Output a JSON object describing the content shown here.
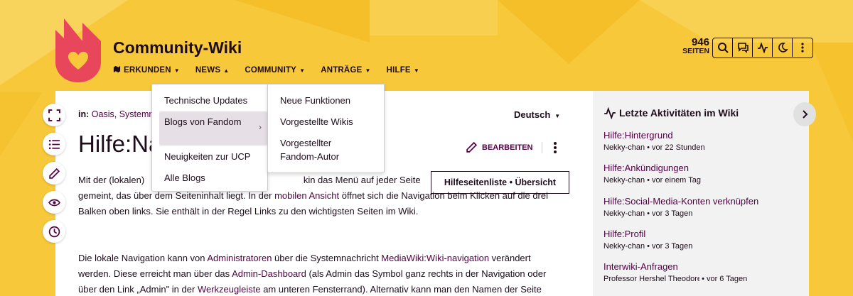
{
  "header": {
    "wiki_title": "Community-Wiki",
    "pages_count": "946",
    "pages_label": "SEITEN"
  },
  "nav": {
    "items": [
      {
        "label": "ERKUNDEN"
      },
      {
        "label": "NEWS"
      },
      {
        "label": "COMMUNITY"
      },
      {
        "label": "ANTRÄGE"
      },
      {
        "label": "HILFE"
      }
    ]
  },
  "dropdown": {
    "items": [
      {
        "label": "Technische Updates"
      },
      {
        "label": "Blogs von Fandom"
      },
      {
        "label": "Neuigkeiten zur UCP"
      },
      {
        "label": "Alle Blogs"
      }
    ],
    "submenu": [
      {
        "label": "Neue Funktionen"
      },
      {
        "label": "Vorgestellte Wikis"
      },
      {
        "label": "Vorgestellter Fandom-Autor"
      }
    ]
  },
  "page": {
    "breadcrumb_prefix": "in:",
    "breadcrumb_link_1": "Oasis",
    "breadcrumb_sep": ",",
    "breadcrumb_link_2": "Systemn",
    "language": "Deutsch",
    "title": "Hilfe:Navigation",
    "edit_label": "BEARBEITEN",
    "help_box": "Hilfeseitenliste • Übersicht",
    "p1a_1": "Mit der (lokalen) ",
    "p1a_2": "kin das Menü auf jeder Seite",
    "p1b_1": "gemeint, das über dem Seiteninhalt liegt. In der ",
    "p1b_link": "mobilen Ansicht",
    "p1b_2": " öffnet sich die Navigation beim Klicken auf die drei Balken oben links. Sie enthält in der Regel Links zu den wichtigsten Seiten im Wiki.",
    "p2_1": "Die lokale Navigation kann von ",
    "p2_link1": "Administratoren",
    "p2_2": " über die Systemnachricht ",
    "p2_link2": "MediaWiki:Wiki-navigation",
    "p2_3": " verändert werden. Diese erreicht man über das ",
    "p2_link3": "Admin-Dashboard",
    "p2_4": " (als Admin das Symbol ganz rechts in der Navigation oder über den Link „Admin\" in der ",
    "p2_link4": "Werkzeugleiste",
    "p2_5": " am unteren Fensterrand). Alternativ kann man den Namen der Seite"
  },
  "rail": {
    "title": "Letzte Aktivitäten im Wiki",
    "activities": [
      {
        "title": "Hilfe:Hintergrund",
        "author": "Nekky-chan",
        "time": "• vor 22 Stunden"
      },
      {
        "title": "Hilfe:Ankündigungen",
        "author": "Nekky-chan",
        "time": "• vor einem Tag"
      },
      {
        "title": "Hilfe:Social-Media-Konten verknüpfen",
        "author": "Nekky-chan",
        "time": "• vor 3 Tagen"
      },
      {
        "title": "Hilfe:Profil",
        "author": "Nekky-chan",
        "time": "• vor 3 Tagen"
      },
      {
        "title": "Interwiki-Anfragen",
        "author": "Professor Hershel Theodore",
        "time": "• vor 6 Tagen"
      }
    ]
  },
  "colors": {
    "background": "#f7c93a",
    "accent": "#520044",
    "logo": "#e8465b"
  }
}
